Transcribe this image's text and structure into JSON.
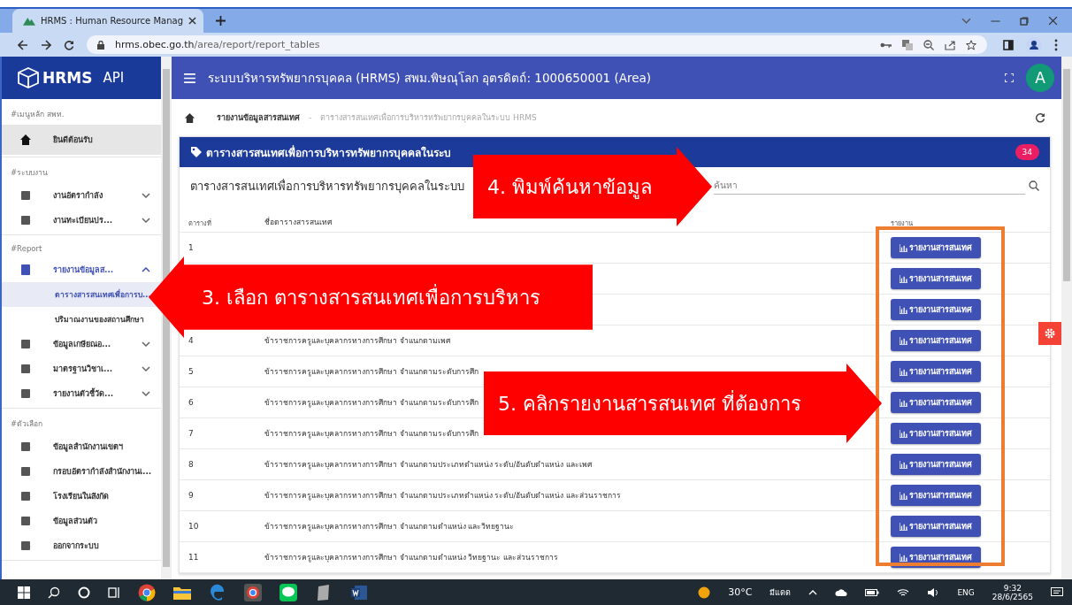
{
  "browser": {
    "tab_title": "HRMS : Human Resource Manag",
    "url_host": "hrms.obec.go.th",
    "url_path": "/area/report/report_tables"
  },
  "sidebar": {
    "logo": "HRMS",
    "logo_sub": "API",
    "sections": [
      {
        "header": "#เมนูหลัก สพท.",
        "items": [
          {
            "label": "ยินดีต้อนรับ",
            "highlighted": true
          }
        ]
      },
      {
        "header": "#ระบบงาน",
        "items": [
          {
            "label": "งานอัตรากำลัง",
            "expanded": false
          },
          {
            "label": "งานทะเบียนปร...",
            "expanded": false
          }
        ]
      },
      {
        "header": "#Report",
        "items": [
          {
            "label": "รายงานข้อมูลส...",
            "expanded": true,
            "children": [
              {
                "label": "ตารางสารสนเทศเพื่อการบ...",
                "selected": true
              },
              {
                "label": "ปริมาณงานของสถานศึกษา",
                "selected": false
              }
            ]
          },
          {
            "label": "ข้อมูลเกษียณอ...",
            "expanded": false
          },
          {
            "label": "มาตรฐานวิชาเ...",
            "expanded": false
          },
          {
            "label": "รายงานตัวชี้วัด...",
            "expanded": false
          }
        ]
      },
      {
        "header": "#ตัวเลือก",
        "items": [
          {
            "label": "ข้อมูลสำนักงานเขตฯ"
          },
          {
            "label": "กรอบอัตรากำลังสำนักงานเ..."
          },
          {
            "label": "โรงเรียนในสังกัด"
          },
          {
            "label": "ข้อมูลส่วนตัว"
          },
          {
            "label": "ออกจากระบบ"
          }
        ]
      }
    ]
  },
  "topbar": {
    "title": "ระบบบริหารทรัพยากรบุคคล (HRMS) สพม.พิษณุโลก อุตรดิตถ์: 1000650001 (Area)",
    "avatar": "A"
  },
  "breadcrumb": [
    "รายงานข้อมูลสารสนเทศ",
    "-",
    "ตารางสารสนเทศเพื่อการบริหารทรัพยากรบุคคลในระบบ HRMS"
  ],
  "card": {
    "title": "ตารางสารสนเทศเพื่อการบริหารทรัพยากรบุคคลในระบ",
    "badge": "34",
    "subtitle": "ตารางสารสนเทศเพื่อการบริหารทรัพยากรบุคคลในระบบ",
    "search": {
      "placeholder": "ค้นหา"
    },
    "columns": [
      "ตารางที่",
      "ชื่อตารางสารสนเทศ",
      "รายงาน"
    ],
    "rows": [
      {
        "no": "1",
        "button": "รายงานสารสนเทศ"
      },
      {
        "button": "รายงานสารสนเทศ"
      },
      {
        "button": "รายงานสารสนเทศ"
      },
      {
        "no": "4",
        "name": "ข้าราชการครูและบุคลากรทางการศึกษา จำแนกตามเพศ",
        "button": "รายงานสารสนเทศ"
      },
      {
        "no": "5",
        "name": "ข้าราชการครูและบุคลากรทางการศึกษา จำแนกตามระดับการศึก",
        "button": "รายงานสารสนเทศ"
      },
      {
        "no": "6",
        "name": "ข้าราชการครูและบุคลากรทางการศึกษา จำแนกตามระดับการศึก",
        "button": "รายงานสารสนเทศ"
      },
      {
        "no": "7",
        "name": "ข้าราชการครูและบุคลากรทางการศึกษา จำแนกตามระดับการศึก",
        "button": "รายงานสารสนเทศ"
      },
      {
        "no": "8",
        "name": "ข้าราชการครูและบุคลากรทางการศึกษา จำแนกตามประเภทตำแหน่ง ระดับ/อันดับตำแหน่ง และเพศ",
        "button": "รายงานสารสนเทศ"
      },
      {
        "no": "9",
        "name": "ข้าราชการครูและบุคลากรทางการศึกษา จำแนกตามประเภทตำแหน่ง ระดับ/อันดับตำแหน่ง และส่วนราชการ",
        "button": "รายงานสารสนเทศ"
      },
      {
        "no": "10",
        "name": "ข้าราชการครูและบุคลากรทางการศึกษา จำแนกตามตำแหน่ง และวิทยฐานะ",
        "button": "รายงานสารสนเทศ"
      },
      {
        "no": "11",
        "name": "ข้าราชการครูและบุคลากรทางการศึกษา จำแนกตามตำแหน่ง วิทยฐานะ และส่วนราชการ",
        "button": "รายงานสารสนเทศ"
      }
    ]
  },
  "callouts": [
    {
      "kind": "right",
      "text": "4. พิมพ์ค้นหาข้อมูล"
    },
    {
      "kind": "left",
      "text": "3. เลือก ตารางสารสนเทศเพื่อการบริหาร"
    },
    {
      "kind": "right",
      "text": "5. คลิกรายงานสารสนเทศ ที่ต้องการ"
    }
  ],
  "taskbar": {
    "weather": "30°C",
    "weather_text": "มีแดด",
    "lang": "ENG",
    "time": "9:32",
    "date": "28/6/2565"
  }
}
